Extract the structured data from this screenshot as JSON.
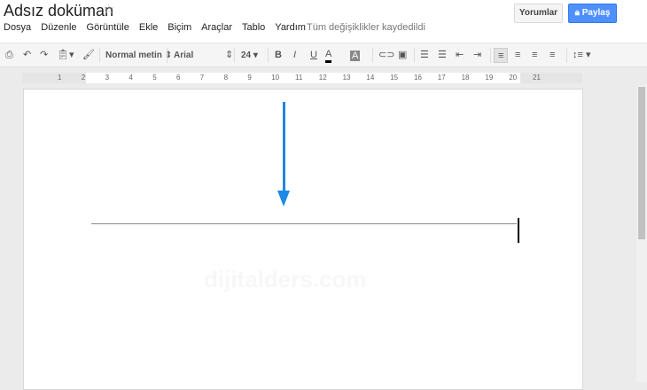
{
  "doc": {
    "title": "Adsız doküman",
    "saved_status": "Tüm değişiklikler kaydedildi"
  },
  "menu": [
    "Dosya",
    "Düzenle",
    "Görüntüle",
    "Ekle",
    "Biçim",
    "Araçlar",
    "Tablo",
    "Yardım"
  ],
  "buttons": {
    "comments": "Yorumlar",
    "share": "Paylaş"
  },
  "toolbar": {
    "style": "Normal metin",
    "font": "Arial",
    "size": "24",
    "bold": "B",
    "italic": "I",
    "underline": "U",
    "text_color": "A",
    "highlight": "A"
  },
  "ruler": {
    "numbers": [
      "1",
      "2",
      "3",
      "4",
      "5",
      "6",
      "7",
      "8",
      "9",
      "10",
      "11",
      "12",
      "13",
      "14",
      "15",
      "16",
      "17",
      "18",
      "19",
      "20",
      "21"
    ]
  },
  "watermark": "dijitalders.com",
  "colors": {
    "share": "#4d90fe",
    "arrow": "#1e88e5"
  }
}
